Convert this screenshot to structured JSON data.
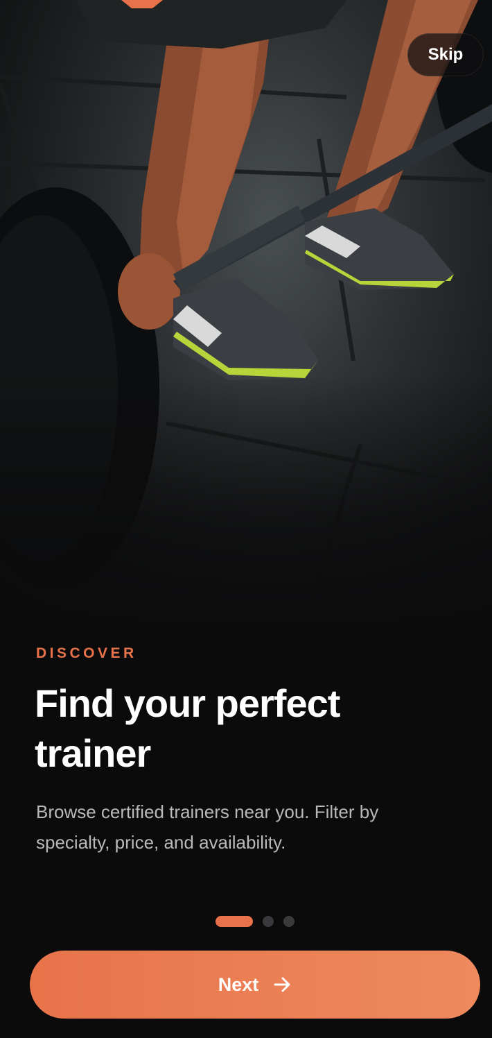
{
  "onboarding": {
    "skip_label": "Skip",
    "eyebrow": "DISCOVER",
    "title": "Find your perfect trainer",
    "description": "Browse certified trainers near you. Filter by specialty, price, and availability.",
    "pager": {
      "total": 3,
      "active_index": 0
    },
    "next_label": "Next"
  },
  "icons": {
    "next_button": "arrow-right-icon"
  },
  "colors": {
    "accent": "#e8734a",
    "background": "#0b0b0c",
    "text_primary": "#ffffff",
    "text_secondary": "#b9b9bc",
    "dot_inactive": "#3a3a3d"
  }
}
